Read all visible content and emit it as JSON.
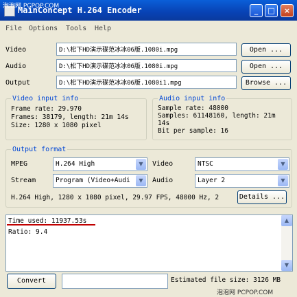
{
  "window": {
    "title": "MainConcept H.264 Encoder",
    "watermark_top": "泡泡网 PCPOP.COM",
    "watermark_bottom": "泡泡网 PCPOP.COM",
    "buttons": {
      "minimize": "_",
      "maximize": "□",
      "close": "×"
    }
  },
  "menu": [
    "File",
    "Options",
    "Tools",
    "Help"
  ],
  "files": [
    {
      "label": "Video",
      "value": "D:\\松下HD演示碟范冰冰06版.1080i.mpg",
      "button": "Open ..."
    },
    {
      "label": "Audio",
      "value": "D:\\松下HD演示碟范冰冰06版.1080i.mpg",
      "button": "Open ..."
    },
    {
      "label": "Output",
      "value": "D:\\松下HD演示碟范冰冰06版.1080i1.mpg",
      "button": "Browse ..."
    }
  ],
  "video_info": {
    "title": "Video input info",
    "lines": [
      "Frame rate: 29.970",
      "Frames: 38179, length: 21m 14s",
      "Size: 1280 x 1080 pixel"
    ]
  },
  "audio_info": {
    "title": "Audio input info",
    "lines": [
      "Sample rate: 48000",
      "Samples: 61148160, length: 21m",
      "14s",
      "Bit per sample: 16"
    ]
  },
  "output_format": {
    "title": "Output format",
    "mpeg_label": "MPEG",
    "mpeg_value": "H.264 High",
    "stream_label": "Stream",
    "stream_value": "Program (Video+Audi",
    "video_label": "Video",
    "video_value": "NTSC",
    "audio_label": "Audio",
    "audio_value": "Layer 2",
    "summary": "H.264 High, 1280 x 1080 pixel, 29.97 FPS, 48000 Hz, 2",
    "details_button": "Details ..."
  },
  "log": {
    "lines": [
      "Time used: 11937.53s",
      "Ratio: 9.4"
    ]
  },
  "footer": {
    "convert_button": "Convert",
    "progress_text": "",
    "estimated": "Estimated file size: 3126 MB"
  },
  "colors": {
    "title_bar": "#0842b4",
    "group_title": "#0046d5",
    "highlight_line": "#c00000"
  }
}
